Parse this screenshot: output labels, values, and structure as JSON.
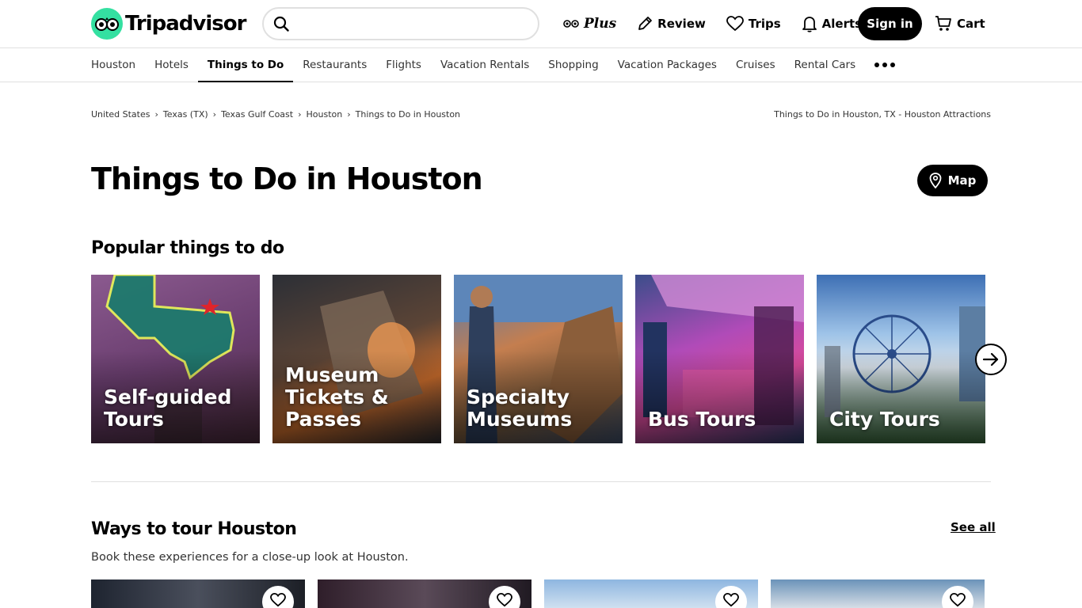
{
  "header": {
    "brand": "Tripadvisor",
    "search": {
      "value": "",
      "placeholder": ""
    },
    "actions": {
      "plus": "Plus",
      "review": "Review",
      "trips": "Trips",
      "alerts": "Alerts",
      "signin": "Sign in",
      "cart": "Cart"
    }
  },
  "tabs": [
    {
      "label": "Houston"
    },
    {
      "label": "Hotels"
    },
    {
      "label": "Things to Do",
      "active": true
    },
    {
      "label": "Restaurants"
    },
    {
      "label": "Flights"
    },
    {
      "label": "Vacation Rentals"
    },
    {
      "label": "Shopping"
    },
    {
      "label": "Vacation Packages"
    },
    {
      "label": "Cruises"
    },
    {
      "label": "Rental Cars"
    }
  ],
  "breadcrumb": {
    "items": [
      "United States",
      "Texas (TX)",
      "Texas Gulf Coast",
      "Houston",
      "Things to Do in Houston"
    ],
    "right_title": "Things to Do in Houston, TX - Houston Attractions"
  },
  "page": {
    "title": "Things to Do in Houston",
    "map_label": "Map"
  },
  "popular": {
    "title": "Popular things to do",
    "cards": [
      {
        "label": "Self-guided Tours"
      },
      {
        "label": "Museum Tickets & Passes"
      },
      {
        "label": "Specialty Museums"
      },
      {
        "label": "Bus Tours"
      },
      {
        "label": "City Tours"
      }
    ]
  },
  "ways": {
    "title": "Ways to tour Houston",
    "see_all": "See all",
    "subtitle": "Book these experiences for a close-up look at Houston."
  },
  "colors": {
    "brand_green": "#34e0a1",
    "text": "#000000",
    "border": "#e0e0e0"
  }
}
